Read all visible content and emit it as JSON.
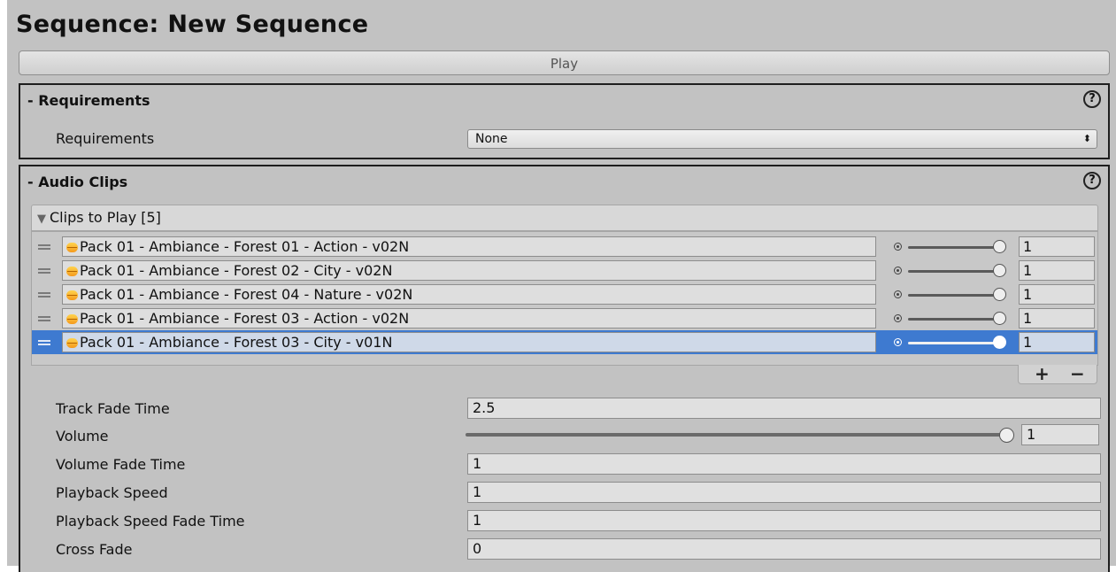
{
  "title": "Sequence: New Sequence",
  "play_label": "Play",
  "requirements_section": {
    "header": "- Requirements",
    "help": "?",
    "label": "Requirements",
    "value": "None",
    "arrow": "⬍"
  },
  "audio_section": {
    "header": "- Audio Clips",
    "help": "?",
    "list_header": "Clips to Play [5]",
    "clips": [
      {
        "name": "Pack 01 - Ambiance - Forest 01 - Action - v02N",
        "value": "1",
        "level": 1.0
      },
      {
        "name": "Pack 01 - Ambiance - Forest 02 - City - v02N",
        "value": "1",
        "level": 1.0
      },
      {
        "name": "Pack 01 - Ambiance - Forest 04 - Nature - v02N",
        "value": "1",
        "level": 1.0
      },
      {
        "name": "Pack 01 - Ambiance - Forest 03 - Action - v02N",
        "value": "1",
        "level": 1.0
      },
      {
        "name": "Pack 01 - Ambiance - Forest 03 - City - v01N",
        "value": "1",
        "level": 1.0,
        "selected": true
      }
    ],
    "add": "+",
    "remove": "−",
    "fields": {
      "track_fade_time": {
        "label": "Track Fade Time",
        "value": "2.5"
      },
      "volume": {
        "label": "Volume",
        "value": "1",
        "level": 1.0
      },
      "volume_fade_time": {
        "label": "Volume Fade Time",
        "value": "1"
      },
      "playback_speed": {
        "label": "Playback Speed",
        "value": "1"
      },
      "playback_speed_fade_time": {
        "label": "Playback Speed Fade Time",
        "value": "1"
      },
      "cross_fade": {
        "label": "Cross Fade",
        "value": "0"
      }
    }
  },
  "colors": {
    "panel": "#c2c2c2",
    "selection": "#3e7ad0",
    "clip_icon": "#f5a623"
  }
}
